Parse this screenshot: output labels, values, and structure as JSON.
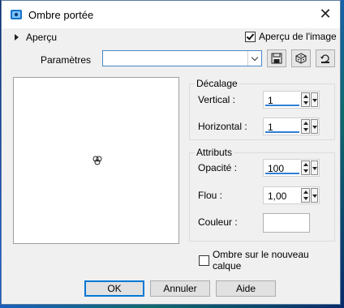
{
  "window": {
    "title": "Ombre portée",
    "close_glyph": "✕"
  },
  "apercu": {
    "toggle_label": "Aperçu",
    "image_preview_label": "Aperçu de l'image",
    "image_preview_checked": true
  },
  "parametres": {
    "label": "Paramètres",
    "value": "",
    "icons": [
      "save-icon",
      "dice-icon",
      "reset-icon"
    ]
  },
  "decalage": {
    "title": "Décalage",
    "vertical_label": "Vertical :",
    "vertical_value": "1",
    "horizontal_label": "Horizontal :",
    "horizontal_value": "1"
  },
  "attributs": {
    "title": "Attributs",
    "opacite_label": "Opacité :",
    "opacite_value": "100",
    "flou_label": "Flou :",
    "flou_value": "1,00",
    "couleur_label": "Couleur :",
    "couleur_value": "#ffffff"
  },
  "ombre_calque": {
    "label": "Ombre sur le nouveau calque",
    "checked": false
  },
  "buttons": {
    "ok": "OK",
    "cancel": "Annuler",
    "help": "Aide"
  },
  "colors": {
    "accent": "#2f7fd6",
    "window_bg": "#f0f0f0"
  }
}
